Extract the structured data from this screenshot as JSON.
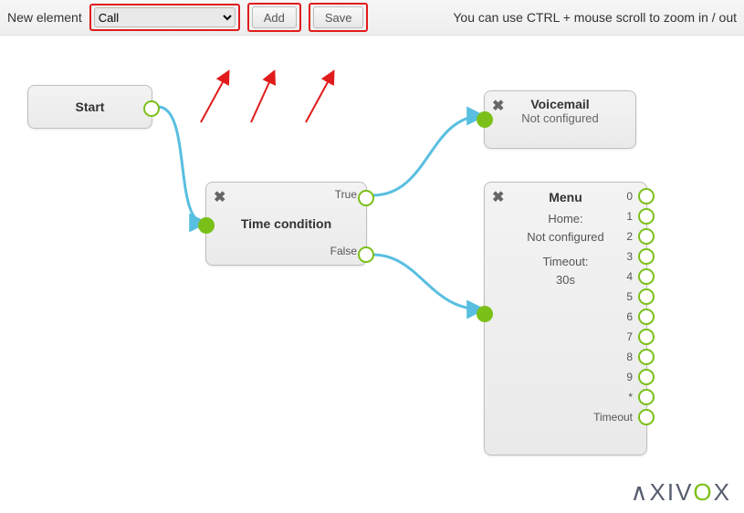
{
  "toolbar": {
    "label": "New element",
    "select_value": "Call",
    "add_label": "Add",
    "save_label": "Save",
    "hint": "You can use CTRL + mouse scroll to zoom in / out"
  },
  "nodes": {
    "start": {
      "title": "Start"
    },
    "time_condition": {
      "title": "Time condition",
      "out_true": "True",
      "out_false": "False"
    },
    "voicemail": {
      "title": "Voicemail",
      "status": "Not configured"
    },
    "menu": {
      "title": "Menu",
      "home_label": "Home:",
      "home_value": "Not configured",
      "timeout_label": "Timeout:",
      "timeout_value": "30s",
      "outputs": [
        "0",
        "1",
        "2",
        "3",
        "4",
        "5",
        "6",
        "7",
        "8",
        "9",
        "*",
        "Timeout"
      ]
    }
  },
  "brand": {
    "name": "AXIVOX"
  }
}
